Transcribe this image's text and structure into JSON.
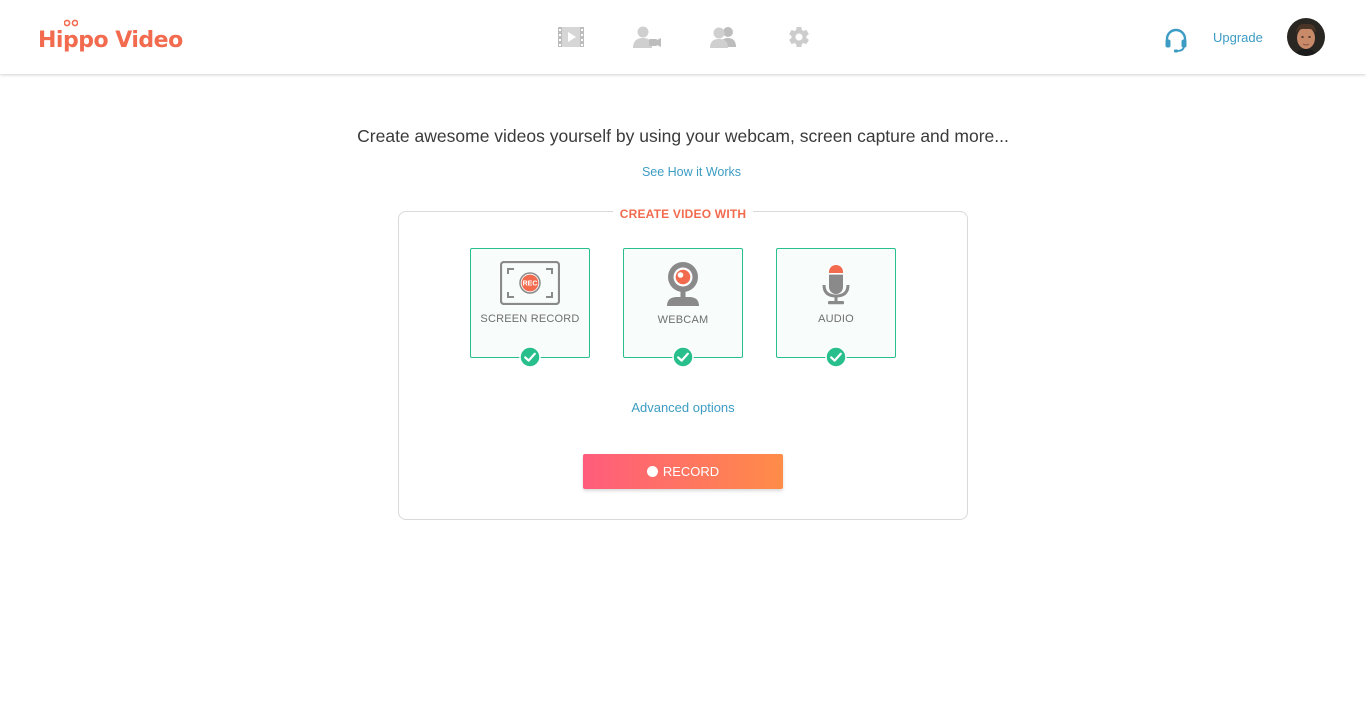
{
  "header": {
    "logo_text": "Hippo Video",
    "brand_color": "#f26b4f",
    "nav": [
      {
        "icon": "video-library-icon"
      },
      {
        "icon": "webcam-person-icon"
      },
      {
        "icon": "users-icon"
      },
      {
        "icon": "gear-icon"
      }
    ],
    "help_icon": "headset-icon",
    "upgrade_label": "Upgrade",
    "avatar": "user-avatar"
  },
  "main": {
    "tagline": "Create awesome videos yourself by using your webcam, screen capture and more...",
    "how_link": "See How it Works",
    "card": {
      "legend": "CREATE VIDEO WITH",
      "options": [
        {
          "label": "SCREEN RECORD",
          "icon": "screen-record-icon",
          "badge": "REC",
          "selected": true
        },
        {
          "label": "WEBCAM",
          "icon": "webcam-icon",
          "selected": true
        },
        {
          "label": "AUDIO",
          "icon": "microphone-icon",
          "selected": true
        }
      ],
      "advanced_label": "Advanced options",
      "record_label": "RECORD"
    }
  },
  "colors": {
    "accent_link": "#3c9cc4",
    "selected_border": "#29bf8c",
    "record_gradient_start": "#ff5c7c",
    "record_gradient_end": "#ff8c48"
  }
}
